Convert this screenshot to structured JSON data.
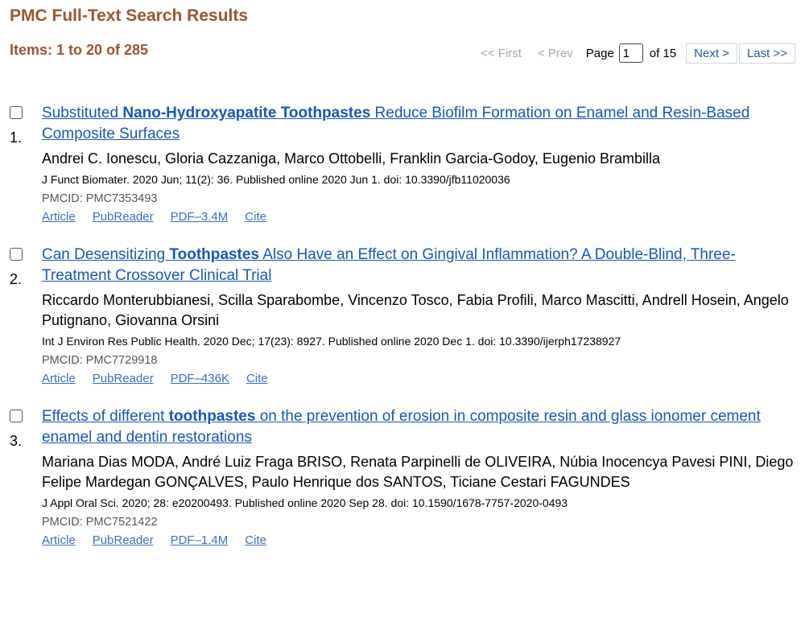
{
  "header": {
    "title": "PMC Full-Text Search Results",
    "items_label": "Items: 1 to 20 of 285"
  },
  "pager": {
    "first": "<< First",
    "prev": "< Prev",
    "page_label": "Page",
    "page_value": "1",
    "of_label": "of 15",
    "next": "Next >",
    "last": "Last >>"
  },
  "results": [
    {
      "num": "1.",
      "title_pre": "Substituted ",
      "title_bold": "Nano-Hydroxyapatite Toothpastes",
      "title_post": " Reduce Biofilm Formation on Enamel and Resin-Based Composite Surfaces",
      "authors": "Andrei C. Ionescu, Gloria Cazzaniga, Marco Ottobelli, Franklin Garcia-Godoy, Eugenio Brambilla",
      "citation": "J Funct Biomater. 2020 Jun; 11(2): 36. Published online 2020 Jun 1. doi: 10.3390/jfb11020036",
      "pmcid": "PMCID: PMC7353493",
      "links": [
        "Article",
        "PubReader",
        "PDF–3.4M",
        "Cite"
      ]
    },
    {
      "num": "2.",
      "title_pre": "Can Desensitizing ",
      "title_bold": "Toothpastes",
      "title_post": " Also Have an Effect on Gingival Inflammation? A Double-Blind, Three-Treatment Crossover Clinical Trial",
      "authors": "Riccardo Monterubbianesi, Scilla Sparabombe, Vincenzo Tosco, Fabia Profili, Marco Mascitti, Andrell Hosein, Angelo Putignano, Giovanna Orsini",
      "citation": "Int J Environ Res Public Health. 2020 Dec; 17(23): 8927. Published online 2020 Dec 1. doi: 10.3390/ijerph17238927",
      "pmcid": "PMCID: PMC7729918",
      "links": [
        "Article",
        "PubReader",
        "PDF–436K",
        "Cite"
      ]
    },
    {
      "num": "3.",
      "title_pre": "Effects of different ",
      "title_bold": "toothpastes",
      "title_post": " on the prevention of erosion in composite resin and glass ionomer cement enamel and dentin restorations",
      "authors": "Mariana Dias MODA, André Luiz Fraga BRISO, Renata Parpinelli de OLIVEIRA, Núbia Inocencya Pavesi PINI, Diego Felipe Mardegan GONÇALVES, Paulo Henrique dos SANTOS, Ticiane Cestari FAGUNDES",
      "citation": "J Appl Oral Sci. 2020; 28: e20200493. Published online 2020 Sep 28. doi: 10.1590/1678-7757-2020-0493",
      "pmcid": "PMCID: PMC7521422",
      "links": [
        "Article",
        "PubReader",
        "PDF–1.4M",
        "Cite"
      ]
    }
  ]
}
